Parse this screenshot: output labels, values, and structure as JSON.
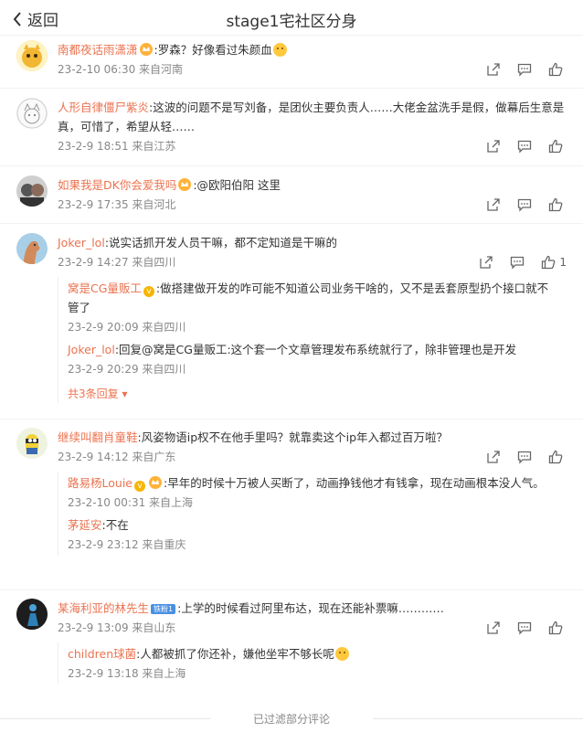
{
  "header": {
    "back_label": "返回",
    "title": "stage1宅社区分身"
  },
  "comments": [
    {
      "user": "南都夜话雨潇潇",
      "text": ":罗森？好像看过朱颜血",
      "time": "23-2-10 06:30 来自河南",
      "likes": ""
    },
    {
      "user": "人形自律僵尸紫炎",
      "text": ":这波的问题不是写刘备，是团伙主要负责人……大佬金盆洗手是假，做幕后生意是真，可惜了，希望从轻……",
      "time": "23-2-9 18:51 来自江苏",
      "likes": ""
    },
    {
      "user": "如果我是DK你会爱我吗",
      "text": ":@欧阳伯阳 这里",
      "time": "23-2-9 17:35 来自河北",
      "likes": ""
    },
    {
      "user": "Joker_lol",
      "text": ":说实话抓开发人员干嘛，都不定知道是干嘛的",
      "time": "23-2-9 14:27 来自四川",
      "likes": "1",
      "replies": [
        {
          "user": "窝是CG量贩工",
          "text": ":做搭建做开发的咋可能不知道公司业务干啥的，又不是丢套原型扔个接口就不管了",
          "time": "23-2-9 20:09 来自四川"
        },
        {
          "user": "Joker_lol",
          "text": ":回复@窝是CG量贩工:这个套一个文章管理发布系统就行了，除非管理也是开发",
          "time": "23-2-9 20:29 来自四川"
        }
      ],
      "more_label": "共3条回复"
    },
    {
      "user": "继续叫翻肖童鞋",
      "text": ":风姿物语ip权不在他手里吗？就靠卖这个ip年入都过百万啦？",
      "time": "23-2-9 14:12 来自广东",
      "likes": "",
      "replies": [
        {
          "user": "路易杨Louie",
          "text": ":早年的时候十万被人买断了，动画挣钱他才有钱拿，现在动画根本没人气。",
          "time": "23-2-10 00:31 来自上海"
        },
        {
          "user": "茅延安",
          "text": ":不在",
          "time": "23-2-9 23:12 来自重庆"
        }
      ]
    },
    {
      "user": "某海利亚的林先生",
      "badge": "铁粉1",
      "text": ":上学的时候看过阿里布达，现在还能补票嘛…………",
      "time": "23-2-9 13:09 来自山东",
      "likes": "",
      "replies": [
        {
          "user": "children球菌",
          "text": ":人都被抓了你还补，嫌他坐牢不够长呢",
          "time": "23-2-9 13:18 来自上海"
        }
      ]
    }
  ],
  "footer": {
    "label": "已过滤部分评论"
  }
}
